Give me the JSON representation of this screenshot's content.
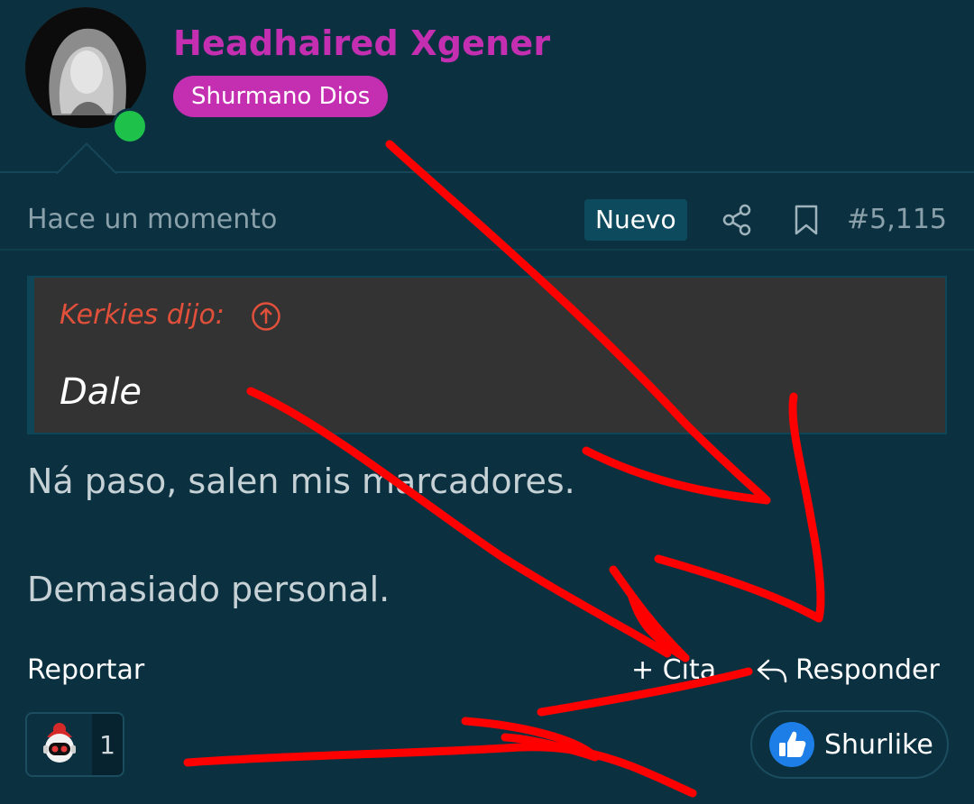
{
  "author": {
    "name": "Headhaired Xgener",
    "rank": "Shurmano Dios",
    "online": true
  },
  "post_meta": {
    "timestamp": "Hace un momento",
    "new_badge": "Nuevo",
    "post_number": "#5,115"
  },
  "quote": {
    "attribution": "Kerkies dijo:",
    "text": "Dale"
  },
  "body": {
    "line1": "Ná paso, salen mis marcadores.",
    "line2": "Demasiado personal."
  },
  "actions": {
    "report": "Reportar",
    "quote": "+ Cita",
    "reply": "Responder"
  },
  "reactions": {
    "count": "1"
  },
  "like_button": {
    "label": "Shurlike"
  },
  "colors": {
    "background": "#0b3141",
    "username": "#c42fb2",
    "rank_badge": "#c42fb2",
    "quote_attribution": "#e0503a",
    "online": "#1ec24a",
    "annotation": "#ff0000"
  }
}
